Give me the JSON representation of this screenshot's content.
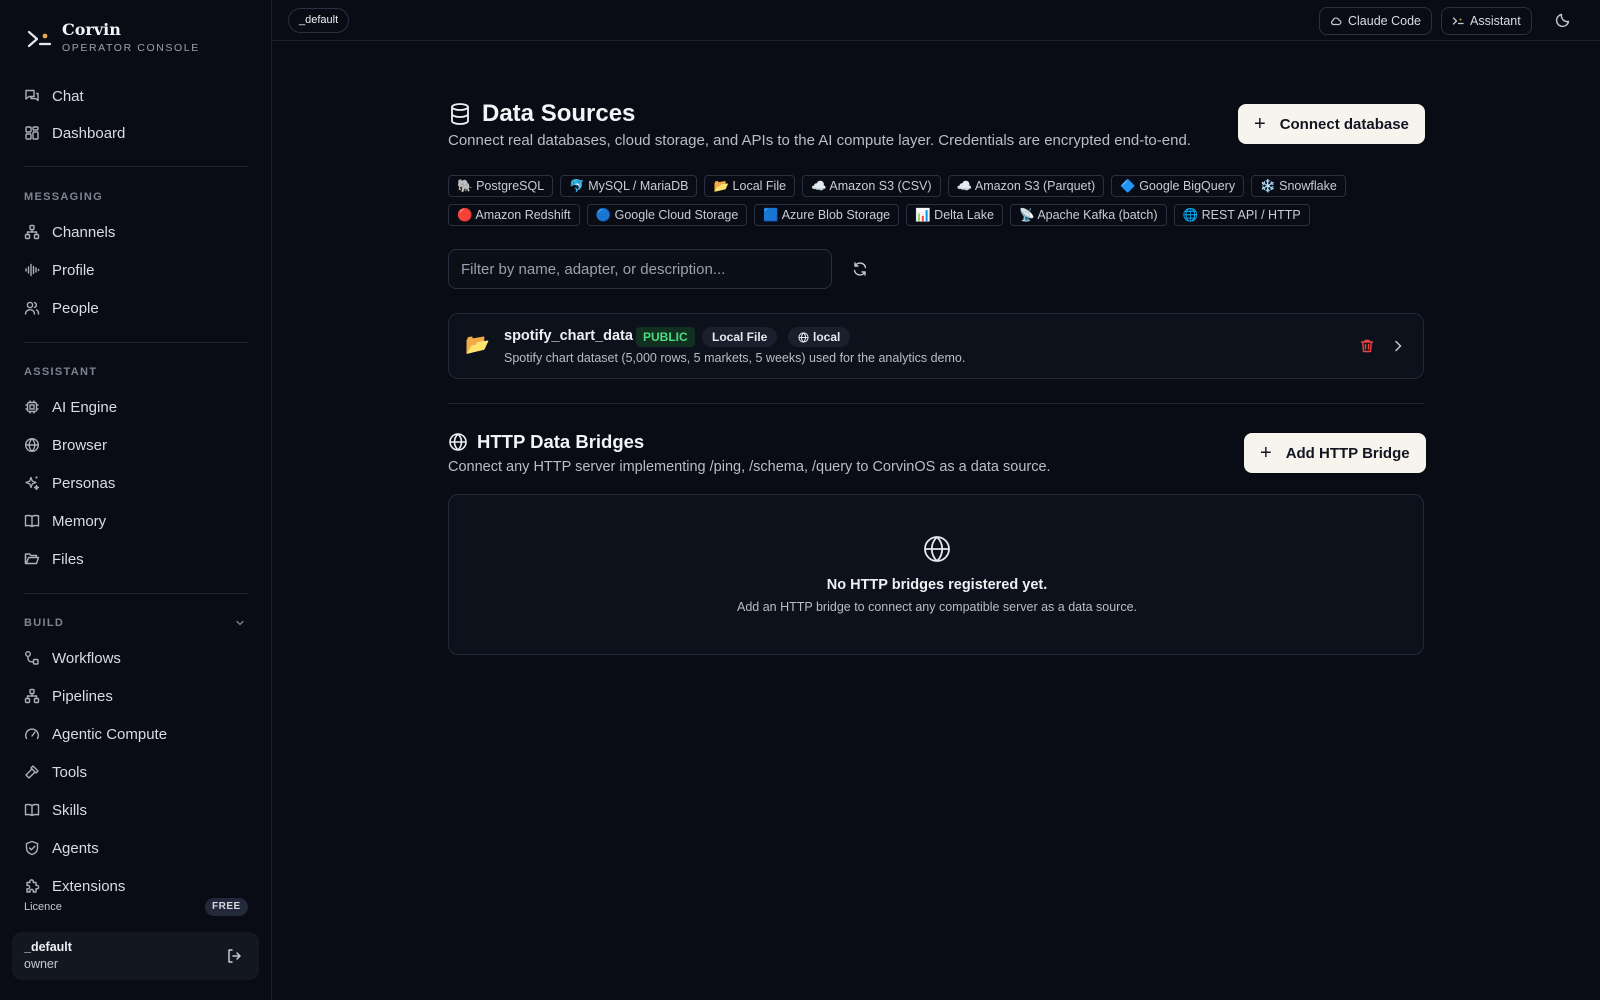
{
  "brand": {
    "name": "Corvin",
    "subtitle": "OPERATOR CONSOLE"
  },
  "sidebar": {
    "top_items": [
      {
        "label": "Chat",
        "icon": "chat-icon"
      },
      {
        "label": "Dashboard",
        "icon": "dashboard-icon"
      }
    ],
    "sections": [
      {
        "label": "MESSAGING",
        "items": [
          {
            "label": "Channels",
            "icon": "channels-icon"
          },
          {
            "label": "Profile",
            "icon": "waveform-icon"
          },
          {
            "label": "People",
            "icon": "people-icon"
          }
        ]
      },
      {
        "label": "ASSISTANT",
        "items": [
          {
            "label": "AI Engine",
            "icon": "cpu-icon"
          },
          {
            "label": "Browser",
            "icon": "globe-icon"
          },
          {
            "label": "Personas",
            "icon": "sparkles-icon"
          },
          {
            "label": "Memory",
            "icon": "book-icon"
          },
          {
            "label": "Files",
            "icon": "folder-icon"
          }
        ]
      },
      {
        "label": "BUILD",
        "items": [
          {
            "label": "Workflows",
            "icon": "workflow-icon"
          },
          {
            "label": "Pipelines",
            "icon": "pipeline-icon"
          },
          {
            "label": "Agentic Compute",
            "icon": "gauge-icon"
          },
          {
            "label": "Tools",
            "icon": "hammer-icon"
          },
          {
            "label": "Skills",
            "icon": "book-open-icon"
          },
          {
            "label": "Agents",
            "icon": "shield-icon"
          },
          {
            "label": "Extensions",
            "icon": "puzzle-icon"
          }
        ]
      }
    ],
    "licence_label": "Licence",
    "licence_badge": "FREE",
    "user": {
      "name": "_default",
      "role": "owner"
    }
  },
  "topbar": {
    "workspace": "_default",
    "claude_code_label": "Claude Code",
    "assistant_label": "Assistant"
  },
  "main": {
    "title": "Data Sources",
    "subtitle": "Connect real databases, cloud storage, and APIs to the AI compute layer. Credentials are encrypted end-to-end.",
    "connect_button": "Connect database",
    "adapter_rows": [
      [
        {
          "emoji": "🐘",
          "label": "PostgreSQL"
        },
        {
          "emoji": "🐬",
          "label": "MySQL / MariaDB"
        },
        {
          "emoji": "📂",
          "label": "Local File"
        },
        {
          "emoji": "☁️",
          "label": "Amazon S3 (CSV)"
        },
        {
          "emoji": "☁️",
          "label": "Amazon S3 (Parquet)"
        },
        {
          "emoji": "🔷",
          "label": "Google BigQuery"
        },
        {
          "emoji": "❄️",
          "label": "Snowflake"
        }
      ],
      [
        {
          "emoji": "🔴",
          "label": "Amazon Redshift"
        },
        {
          "emoji": "🔵",
          "label": "Google Cloud Storage"
        },
        {
          "emoji": "🟦",
          "label": "Azure Blob Storage"
        },
        {
          "emoji": "📊",
          "label": "Delta Lake"
        },
        {
          "emoji": "📡",
          "label": "Apache Kafka (batch)"
        },
        {
          "emoji": "🌐",
          "label": "REST API / HTTP"
        }
      ]
    ],
    "filter_placeholder": "Filter by name, adapter, or description...",
    "data_source": {
      "emoji": "📂",
      "name": "spotify_chart_data",
      "visibility": "PUBLIC",
      "adapter": "Local File",
      "scope": "local",
      "description": "Spotify chart dataset (5,000 rows, 5 markets, 5 weeks) used for the analytics demo."
    },
    "bridges": {
      "title": "HTTP Data Bridges",
      "subtitle": "Connect any HTTP server implementing /ping, /schema, /query to CorvinOS as a data source.",
      "add_button": "Add HTTP Bridge",
      "empty_title": "No HTTP bridges registered yet.",
      "empty_subtitle": "Add an HTTP bridge to connect any compatible server as a data source."
    }
  },
  "colors": {
    "background": "#090c14",
    "accent_button": "#f7f4ee",
    "public_badge": "#4ade80",
    "danger": "#ef4444"
  }
}
